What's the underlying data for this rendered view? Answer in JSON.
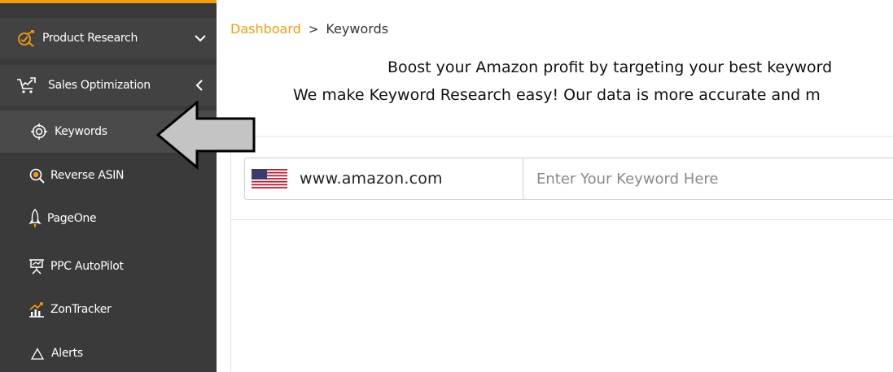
{
  "sidebar": {
    "accent_color": "#f39c12",
    "items": [
      {
        "label": "Product Research",
        "icon": "chart-check-icon"
      },
      {
        "label": "Sales Optimization",
        "icon": "cart-icon"
      },
      {
        "label": "Keywords",
        "icon": "target-icon"
      },
      {
        "label": "Reverse ASIN",
        "icon": "search-dollar-icon"
      },
      {
        "label": "PageOne",
        "icon": "rocket-icon"
      },
      {
        "label": "PPC AutoPilot",
        "icon": "presentation-icon"
      },
      {
        "label": "ZonTracker",
        "icon": "growth-chart-icon"
      },
      {
        "label": "Alerts",
        "icon": "warning-icon"
      }
    ]
  },
  "breadcrumb": {
    "root": "Dashboard",
    "separator": ">",
    "current": "Keywords"
  },
  "headline": {
    "line1": "Boost your Amazon profit by targeting your best keyword",
    "line2": "We make Keyword Research easy! Our data is more accurate and m"
  },
  "search": {
    "marketplace": "www.amazon.com",
    "marketplace_flag": "us-flag-icon",
    "keyword_placeholder": "Enter Your Keyword Here",
    "keyword_value": ""
  }
}
